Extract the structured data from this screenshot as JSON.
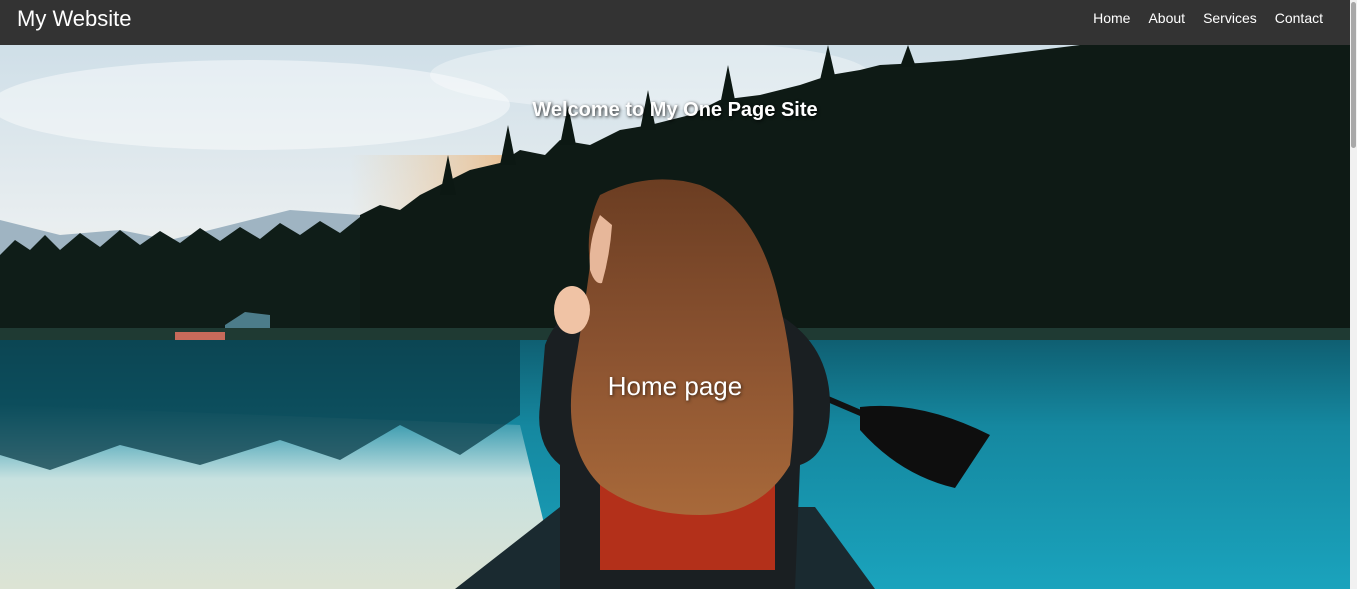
{
  "nav": {
    "brand": "My Website",
    "links": [
      "Home",
      "About",
      "Services",
      "Contact"
    ]
  },
  "hero": {
    "title": "Welcome to My One Page Site",
    "subtitle": "Home page",
    "image_description_icon": "hero-photo"
  },
  "colors": {
    "navbar_bg": "#333333",
    "nav_text": "#ffffff",
    "water": "#1a8aa0",
    "forest": "#0d1a14"
  }
}
